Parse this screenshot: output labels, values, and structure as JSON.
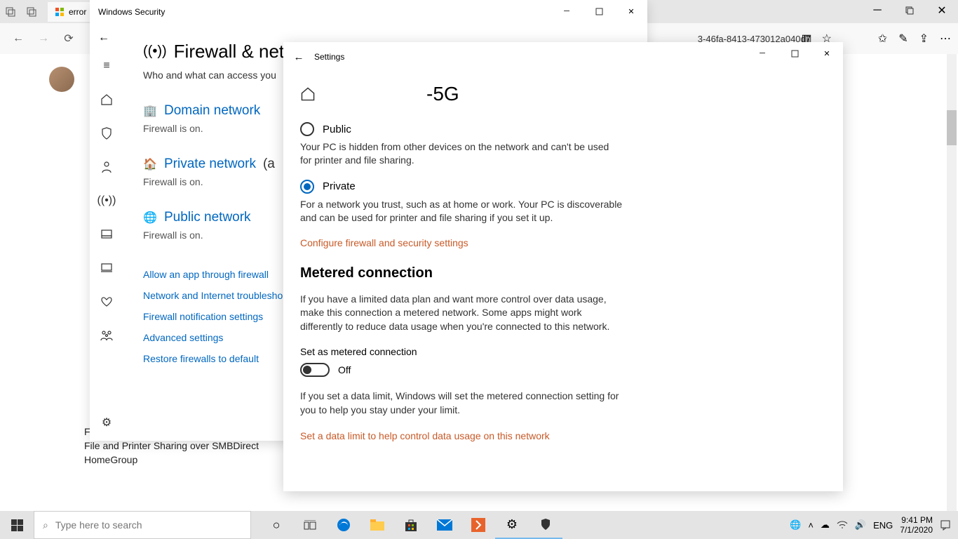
{
  "browser": {
    "tab_title": "error",
    "url_fragment": "3-46fa-8413-473012a040d7"
  },
  "bg_page": {
    "lines": [
      "File and Printer Sharing",
      "File and Printer Sharing over SMBDirect",
      "HomeGroup"
    ]
  },
  "security_window": {
    "title": "Windows Security",
    "page_title": "Firewall & net",
    "subtitle": "Who and what can access you",
    "networks": [
      {
        "label": "Domain network",
        "status": "Firewall is on.",
        "active": ""
      },
      {
        "label": "Private network",
        "status": "Firewall is on.",
        "active": "(a"
      },
      {
        "label": "Public network",
        "status": "Firewall is on.",
        "active": ""
      }
    ],
    "links": [
      "Allow an app through firewall",
      "Network and Internet troublesho",
      "Firewall notification settings",
      "Advanced settings",
      "Restore firewalls to default"
    ]
  },
  "settings_window": {
    "title": "Settings",
    "network_name": "-5G",
    "public": {
      "label": "Public",
      "desc": "Your PC is hidden from other devices on the network and can't be used for printer and file sharing."
    },
    "private": {
      "label": "Private",
      "desc": "For a network you trust, such as at home or work. Your PC is discoverable and can be used for printer and file sharing if you set it up."
    },
    "configure_link": "Configure firewall and security settings",
    "metered": {
      "heading": "Metered connection",
      "desc": "If you have a limited data plan and want more control over data usage, make this connection a metered network. Some apps might work differently to reduce data usage when you're connected to this network.",
      "toggle_label": "Set as metered connection",
      "toggle_state": "Off",
      "limit_desc": "If you set a data limit, Windows will set the metered connection setting for you to help you stay under your limit.",
      "limit_link": "Set a data limit to help control data usage on this network"
    }
  },
  "taskbar": {
    "search_placeholder": "Type here to search",
    "lang": "ENG",
    "time": "9:41 PM",
    "date": "7/1/2020"
  }
}
